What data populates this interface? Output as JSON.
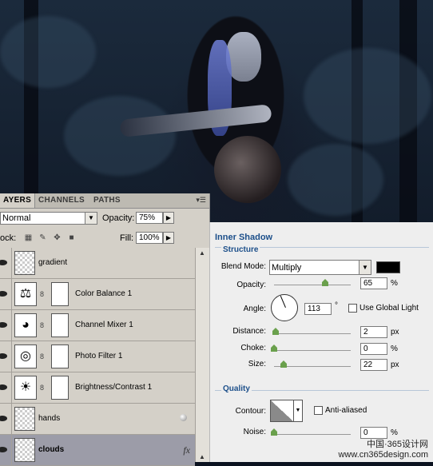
{
  "layers_panel": {
    "tabs": [
      "AYERS",
      "CHANNELS",
      "PATHS"
    ],
    "blend_mode": "Normal",
    "opacity_label": "Opacity:",
    "opacity_value": "75%",
    "lock_label": "ock:",
    "fill_label": "Fill:",
    "fill_value": "100%",
    "layers": [
      {
        "name": "gradient"
      },
      {
        "name": "Color Balance 1"
      },
      {
        "name": "Channel Mixer 1"
      },
      {
        "name": "Photo Filter 1"
      },
      {
        "name": "Brightness/Contrast 1"
      },
      {
        "name": "hands"
      },
      {
        "name": "clouds",
        "fx": "fx"
      }
    ]
  },
  "inner_shadow": {
    "title": "Inner Shadow",
    "structure_label": "Structure",
    "blend_mode_label": "Blend Mode:",
    "blend_mode_value": "Multiply",
    "shadow_color": "#000000",
    "opacity_label": "Opacity:",
    "opacity_value": "65",
    "opacity_unit": "%",
    "angle_label": "Angle:",
    "angle_value": "113",
    "angle_unit": "°",
    "global_light_label": "Use Global Light",
    "distance_label": "Distance:",
    "distance_value": "2",
    "distance_unit": "px",
    "choke_label": "Choke:",
    "choke_value": "0",
    "choke_unit": "%",
    "size_label": "Size:",
    "size_value": "22",
    "size_unit": "px",
    "quality_label": "Quality",
    "contour_label": "Contour:",
    "anti_aliased_label": "Anti-aliased",
    "noise_label": "Noise:",
    "noise_value": "0",
    "noise_unit": "%"
  },
  "watermark": {
    "line1": "中国·365设计网",
    "line2": "www.cn365design.com"
  }
}
